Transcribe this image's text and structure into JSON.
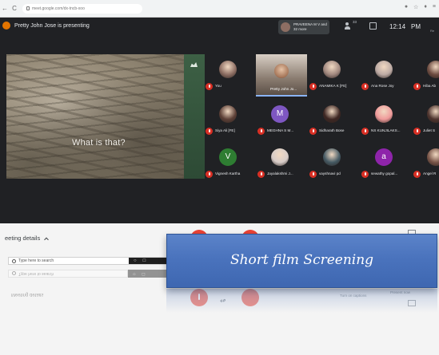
{
  "browser": {
    "url": "meet.google.com/dx-tncb-xoo",
    "nav_back": "←",
    "nav_refresh": "C"
  },
  "meet": {
    "presenter_text": "Pretty John Jose is presenting",
    "participants_chip": "PRAVEENA M V and 32 more",
    "people_count": "33",
    "time": "12:14",
    "ampm": "PM",
    "more_label": "Re",
    "shared_screen_caption": "What is that?",
    "tiles": [
      {
        "name": "You",
        "kind": "photo",
        "color": "#8d6e63"
      },
      {
        "name": "Pretty John Jo...",
        "kind": "active",
        "color": "#8a7c70"
      },
      {
        "name": "ANAMIKA K [FE]",
        "kind": "photo",
        "color": "#a1887f"
      },
      {
        "name": "Ana Rose Joy",
        "kind": "photo",
        "color": "#bcaaa4"
      },
      {
        "name": "Hiba Ab",
        "kind": "photo",
        "color": "#6d4c41"
      },
      {
        "name": "Siya Ali [FE]",
        "kind": "photo",
        "color": "#5d4037"
      },
      {
        "name": "MEGHNA S M...",
        "kind": "letter",
        "letter": "M",
        "color": "#7e57c2"
      },
      {
        "name": "Sidharath Bose",
        "kind": "photo",
        "color": "#3e2723"
      },
      {
        "name": "NS KUNJILAKS...",
        "kind": "photo",
        "color": "#ef9a9a"
      },
      {
        "name": "Juliet S",
        "kind": "photo",
        "color": "#4e342e"
      },
      {
        "name": "Vignesh Kartha",
        "kind": "letter",
        "letter": "V",
        "color": "#2e7d32"
      },
      {
        "name": "Jayalakshmi J...",
        "kind": "photo",
        "color": "#d7ccc8"
      },
      {
        "name": "vayshnavi pd",
        "kind": "photo",
        "color": "#455a64"
      },
      {
        "name": "sewathy gopal...",
        "kind": "letter",
        "letter": "a",
        "color": "#8e24aa"
      },
      {
        "name": "Angel R",
        "kind": "photo",
        "color": "#795548"
      }
    ]
  },
  "lower": {
    "meeting_details": "eeting details",
    "side_text_1": "Turn on captions",
    "side_text_2": "Present now"
  },
  "taskbar": {
    "search_placeholder": "Type here to search",
    "search_reflect": "Type here to search"
  },
  "reflect": {
    "meeting_details_reflect": "Meeting details"
  },
  "title_card": {
    "text": "Short film Screening",
    "color": "#4a73bd"
  }
}
